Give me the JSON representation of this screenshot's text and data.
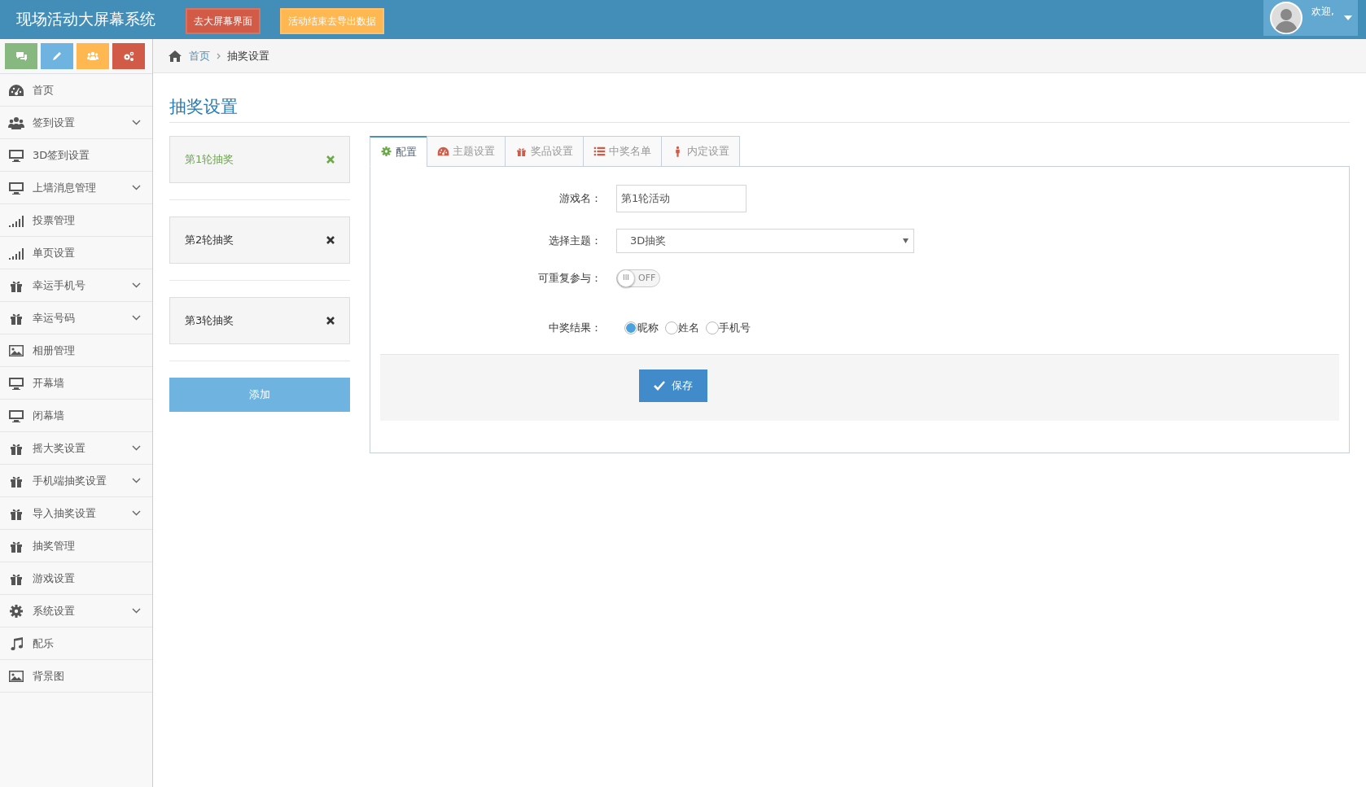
{
  "header": {
    "title": "现场活动大屏幕系统",
    "buttons": [
      {
        "label": "去大屏幕界面",
        "color": "#d15b47"
      },
      {
        "label": "活动结束去导出数据",
        "color": "#ffb752"
      }
    ],
    "user": {
      "greeting": "欢迎,"
    }
  },
  "shortcuts": [
    {
      "color": "#87b87f"
    },
    {
      "color": "#6fb3e0"
    },
    {
      "color": "#ffb752"
    },
    {
      "color": "#d15b47"
    }
  ],
  "sidebar": {
    "items": [
      {
        "label": "首页",
        "expandable": false
      },
      {
        "label": "签到设置",
        "expandable": true
      },
      {
        "label": "3D签到设置",
        "expandable": false
      },
      {
        "label": "上墙消息管理",
        "expandable": true
      },
      {
        "label": "投票管理",
        "expandable": false
      },
      {
        "label": "单页设置",
        "expandable": false
      },
      {
        "label": "幸运手机号",
        "expandable": true
      },
      {
        "label": "幸运号码",
        "expandable": true
      },
      {
        "label": "相册管理",
        "expandable": false
      },
      {
        "label": "开幕墙",
        "expandable": false
      },
      {
        "label": "闭幕墙",
        "expandable": false
      },
      {
        "label": "摇大奖设置",
        "expandable": true
      },
      {
        "label": "手机端抽奖设置",
        "expandable": true
      },
      {
        "label": "导入抽奖设置",
        "expandable": true
      },
      {
        "label": "抽奖管理",
        "expandable": false
      },
      {
        "label": "游戏设置",
        "expandable": false
      },
      {
        "label": "系统设置",
        "expandable": true
      },
      {
        "label": "配乐",
        "expandable": false
      },
      {
        "label": "背景图",
        "expandable": false
      }
    ]
  },
  "breadcrumb": [
    "首页",
    "抽奖设置"
  ],
  "page_title": "抽奖设置",
  "rounds": [
    {
      "label": "第1轮抽奖",
      "selected": true
    },
    {
      "label": "第2轮抽奖",
      "selected": false
    },
    {
      "label": "第3轮抽奖",
      "selected": false
    }
  ],
  "add_button": "添加",
  "tabs": [
    {
      "label": "配置",
      "selected": true
    },
    {
      "label": "主题设置",
      "selected": false
    },
    {
      "label": "奖品设置",
      "selected": false
    },
    {
      "label": "中奖名单",
      "selected": false
    },
    {
      "label": "内定设置",
      "selected": false
    }
  ],
  "form": {
    "game_name": {
      "label": "游戏名：",
      "value": "第1轮活动"
    },
    "theme": {
      "label": "选择主题：",
      "value": "3D抽奖"
    },
    "repeat": {
      "label": "可重复参与：",
      "on": false,
      "handle": "III",
      "state_label": "OFF"
    },
    "result": {
      "label": "中奖结果：",
      "options": [
        {
          "label": "昵称",
          "selected": true
        },
        {
          "label": "姓名",
          "selected": false
        },
        {
          "label": "手机号",
          "selected": false
        }
      ]
    },
    "save_button": "保存"
  }
}
